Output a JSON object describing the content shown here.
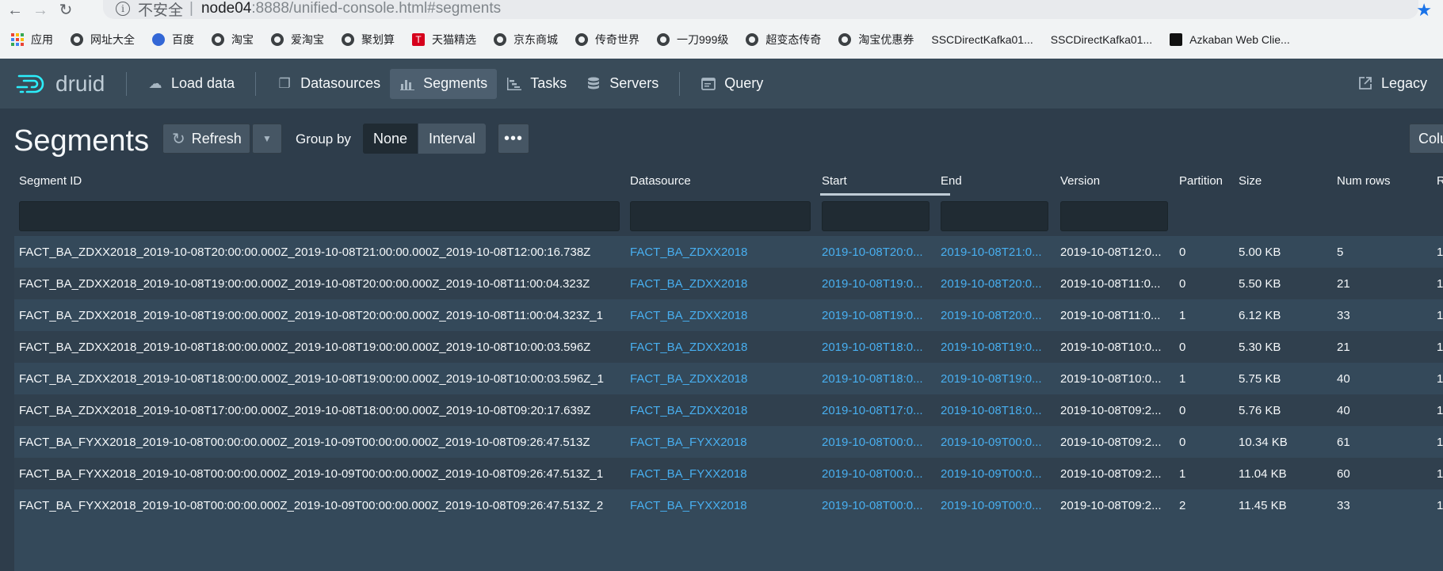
{
  "browser": {
    "insecure_label": "不安全",
    "separator": "|",
    "url_host": "node04",
    "url_path": ":8888/unified-console.html#segments",
    "bookmarks": [
      {
        "label": "应用",
        "icon": "apps-icon"
      },
      {
        "label": "网址大全",
        "icon": "globe-icon"
      },
      {
        "label": "百度",
        "icon": "baidu-icon"
      },
      {
        "label": "淘宝",
        "icon": "globe-icon"
      },
      {
        "label": "爱淘宝",
        "icon": "globe-icon"
      },
      {
        "label": "聚划算",
        "icon": "globe-icon"
      },
      {
        "label": "天猫精选",
        "icon": "tmall-icon"
      },
      {
        "label": "京东商城",
        "icon": "globe-icon"
      },
      {
        "label": "传奇世界",
        "icon": "globe-icon"
      },
      {
        "label": "一刀999级",
        "icon": "globe-icon"
      },
      {
        "label": "超变态传奇",
        "icon": "globe-icon"
      },
      {
        "label": "淘宝优惠券",
        "icon": "globe-icon"
      },
      {
        "label": "SSCDirectKafka01...",
        "icon": "none"
      },
      {
        "label": "SSCDirectKafka01...",
        "icon": "none"
      },
      {
        "label": "Azkaban Web Clie...",
        "icon": "azkaban-icon"
      }
    ]
  },
  "nav": {
    "logo_text": "druid",
    "load_data": "Load data",
    "datasources": "Datasources",
    "segments": "Segments",
    "tasks": "Tasks",
    "servers": "Servers",
    "query": "Query",
    "legacy": "Legacy"
  },
  "toolbar": {
    "title": "Segments",
    "refresh": "Refresh",
    "group_by_label": "Group by",
    "group_none": "None",
    "group_interval": "Interval",
    "more": "•••",
    "columns": "Colu"
  },
  "table": {
    "headers": {
      "segment_id": "Segment ID",
      "datasource": "Datasource",
      "start": "Start",
      "end": "End",
      "version": "Version",
      "partition": "Partition",
      "size": "Size",
      "num_rows": "Num rows",
      "r": "R"
    },
    "rows": [
      {
        "segment_id": "FACT_BA_ZDXX2018_2019-10-08T20:00:00.000Z_2019-10-08T21:00:00.000Z_2019-10-08T12:00:16.738Z",
        "datasource": "FACT_BA_ZDXX2018",
        "start": "2019-10-08T20:0...",
        "end": "2019-10-08T21:0...",
        "version": "2019-10-08T12:0...",
        "partition": "0",
        "size": "5.00 KB",
        "num_rows": "5",
        "r": "1"
      },
      {
        "segment_id": "FACT_BA_ZDXX2018_2019-10-08T19:00:00.000Z_2019-10-08T20:00:00.000Z_2019-10-08T11:00:04.323Z",
        "datasource": "FACT_BA_ZDXX2018",
        "start": "2019-10-08T19:0...",
        "end": "2019-10-08T20:0...",
        "version": "2019-10-08T11:0...",
        "partition": "0",
        "size": "5.50 KB",
        "num_rows": "21",
        "r": "1"
      },
      {
        "segment_id": "FACT_BA_ZDXX2018_2019-10-08T19:00:00.000Z_2019-10-08T20:00:00.000Z_2019-10-08T11:00:04.323Z_1",
        "datasource": "FACT_BA_ZDXX2018",
        "start": "2019-10-08T19:0...",
        "end": "2019-10-08T20:0...",
        "version": "2019-10-08T11:0...",
        "partition": "1",
        "size": "6.12 KB",
        "num_rows": "33",
        "r": "1"
      },
      {
        "segment_id": "FACT_BA_ZDXX2018_2019-10-08T18:00:00.000Z_2019-10-08T19:00:00.000Z_2019-10-08T10:00:03.596Z",
        "datasource": "FACT_BA_ZDXX2018",
        "start": "2019-10-08T18:0...",
        "end": "2019-10-08T19:0...",
        "version": "2019-10-08T10:0...",
        "partition": "0",
        "size": "5.30 KB",
        "num_rows": "21",
        "r": "1"
      },
      {
        "segment_id": "FACT_BA_ZDXX2018_2019-10-08T18:00:00.000Z_2019-10-08T19:00:00.000Z_2019-10-08T10:00:03.596Z_1",
        "datasource": "FACT_BA_ZDXX2018",
        "start": "2019-10-08T18:0...",
        "end": "2019-10-08T19:0...",
        "version": "2019-10-08T10:0...",
        "partition": "1",
        "size": "5.75 KB",
        "num_rows": "40",
        "r": "1"
      },
      {
        "segment_id": "FACT_BA_ZDXX2018_2019-10-08T17:00:00.000Z_2019-10-08T18:00:00.000Z_2019-10-08T09:20:17.639Z",
        "datasource": "FACT_BA_ZDXX2018",
        "start": "2019-10-08T17:0...",
        "end": "2019-10-08T18:0...",
        "version": "2019-10-08T09:2...",
        "partition": "0",
        "size": "5.76 KB",
        "num_rows": "40",
        "r": "1"
      },
      {
        "segment_id": "FACT_BA_FYXX2018_2019-10-08T00:00:00.000Z_2019-10-09T00:00:00.000Z_2019-10-08T09:26:47.513Z",
        "datasource": "FACT_BA_FYXX2018",
        "start": "2019-10-08T00:0...",
        "end": "2019-10-09T00:0...",
        "version": "2019-10-08T09:2...",
        "partition": "0",
        "size": "10.34 KB",
        "num_rows": "61",
        "r": "1"
      },
      {
        "segment_id": "FACT_BA_FYXX2018_2019-10-08T00:00:00.000Z_2019-10-09T00:00:00.000Z_2019-10-08T09:26:47.513Z_1",
        "datasource": "FACT_BA_FYXX2018",
        "start": "2019-10-08T00:0...",
        "end": "2019-10-09T00:0...",
        "version": "2019-10-08T09:2...",
        "partition": "1",
        "size": "11.04 KB",
        "num_rows": "60",
        "r": "1"
      },
      {
        "segment_id": "FACT_BA_FYXX2018_2019-10-08T00:00:00.000Z_2019-10-09T00:00:00.000Z_2019-10-08T09:26:47.513Z_2",
        "datasource": "FACT_BA_FYXX2018",
        "start": "2019-10-08T00:0...",
        "end": "2019-10-09T00:0...",
        "version": "2019-10-08T09:2...",
        "partition": "2",
        "size": "11.45 KB",
        "num_rows": "33",
        "r": "1"
      }
    ]
  }
}
